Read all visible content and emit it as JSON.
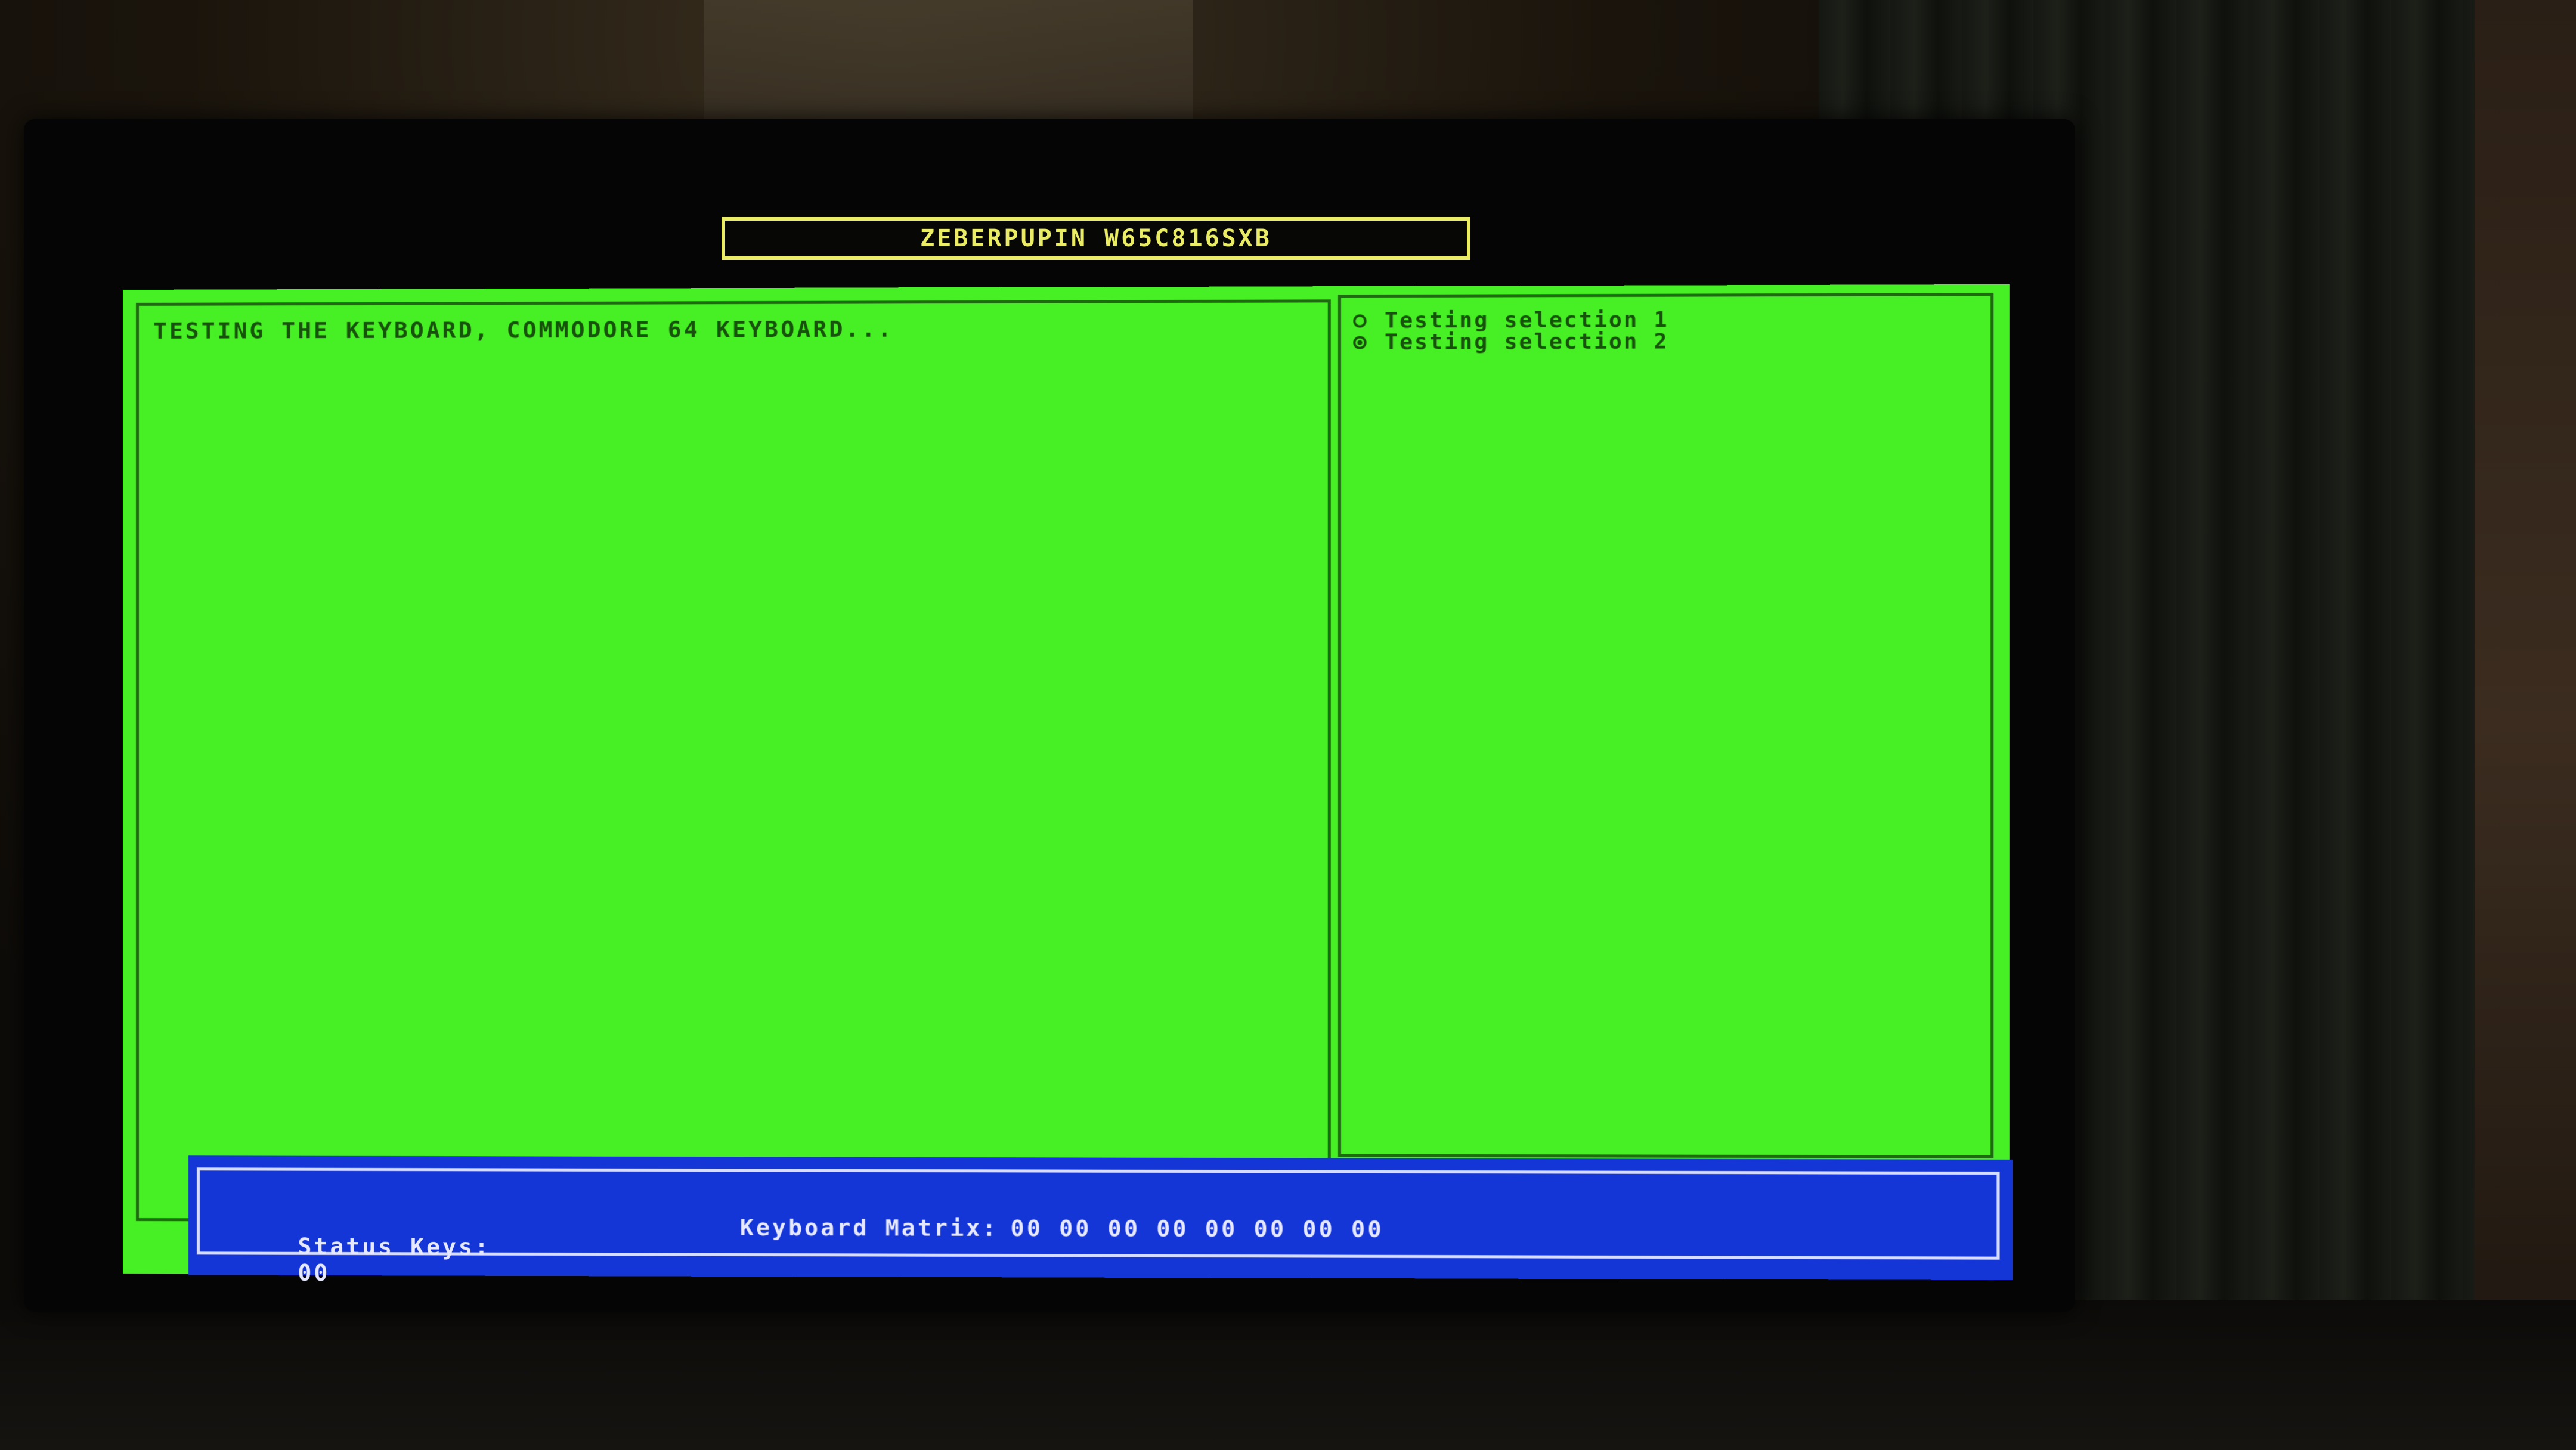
{
  "window": {
    "title": "ZEBERPUPIN W65C816SXB"
  },
  "log_panel": {
    "message": "TESTING THE KEYBOARD, COMMODORE 64 KEYBOARD..."
  },
  "selection_panel": {
    "options": [
      {
        "label": "Testing selection 1",
        "selected": false
      },
      {
        "label": "Testing selection 2",
        "selected": true
      }
    ]
  },
  "status_bar": {
    "status_keys_label": "Status Keys:",
    "status_keys_value": "00",
    "keyboard_matrix_label": "Keyboard Matrix:",
    "keyboard_matrix_value": "00 00 00 00 00 00 00 00"
  },
  "colors": {
    "screen_background": "#47f024",
    "text_dark_green": "#17520c",
    "title_yellow": "#e9ec64",
    "status_bar_blue": "#1536d6",
    "status_text": "#e6e8ff"
  }
}
